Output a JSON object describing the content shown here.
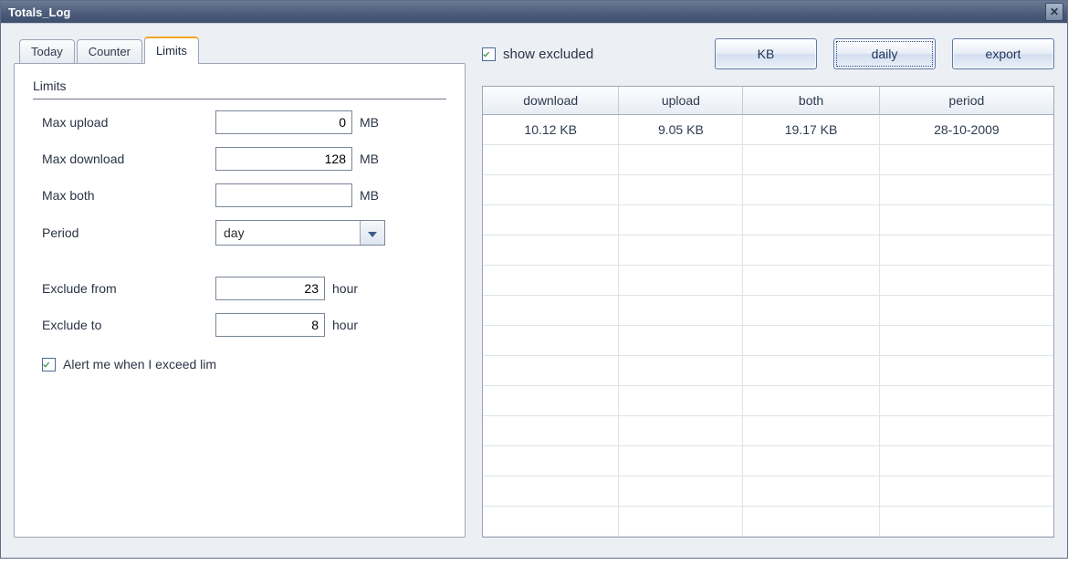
{
  "window": {
    "title": "Totals_Log"
  },
  "tabs": {
    "today": "Today",
    "counter": "Counter",
    "limits": "Limits"
  },
  "limits_panel": {
    "section_title": "Limits",
    "max_upload_label": "Max upload",
    "max_upload_value": "0",
    "max_upload_unit": "MB",
    "max_download_label": "Max download",
    "max_download_value": "128",
    "max_download_unit": "MB",
    "max_both_label": "Max both",
    "max_both_value": "",
    "max_both_unit": "MB",
    "period_label": "Period",
    "period_value": "day",
    "exclude_from_label": "Exclude from",
    "exclude_from_value": "23",
    "exclude_from_unit": "hour",
    "exclude_to_label": "Exclude to",
    "exclude_to_value": "8",
    "exclude_to_unit": "hour",
    "alert_label": "Alert me when I exceed lim",
    "alert_checked": true
  },
  "toolbar": {
    "show_excluded_label": "show excluded",
    "show_excluded_checked": true,
    "kb_button": "KB",
    "daily_button": "daily",
    "export_button": "export"
  },
  "table": {
    "headers": {
      "download": "download",
      "upload": "upload",
      "both": "both",
      "period": "period"
    },
    "rows": [
      {
        "download": "10.12 KB",
        "upload": "9.05 KB",
        "both": "19.17 KB",
        "period": "28-10-2009"
      }
    ],
    "empty_rows": 13
  }
}
